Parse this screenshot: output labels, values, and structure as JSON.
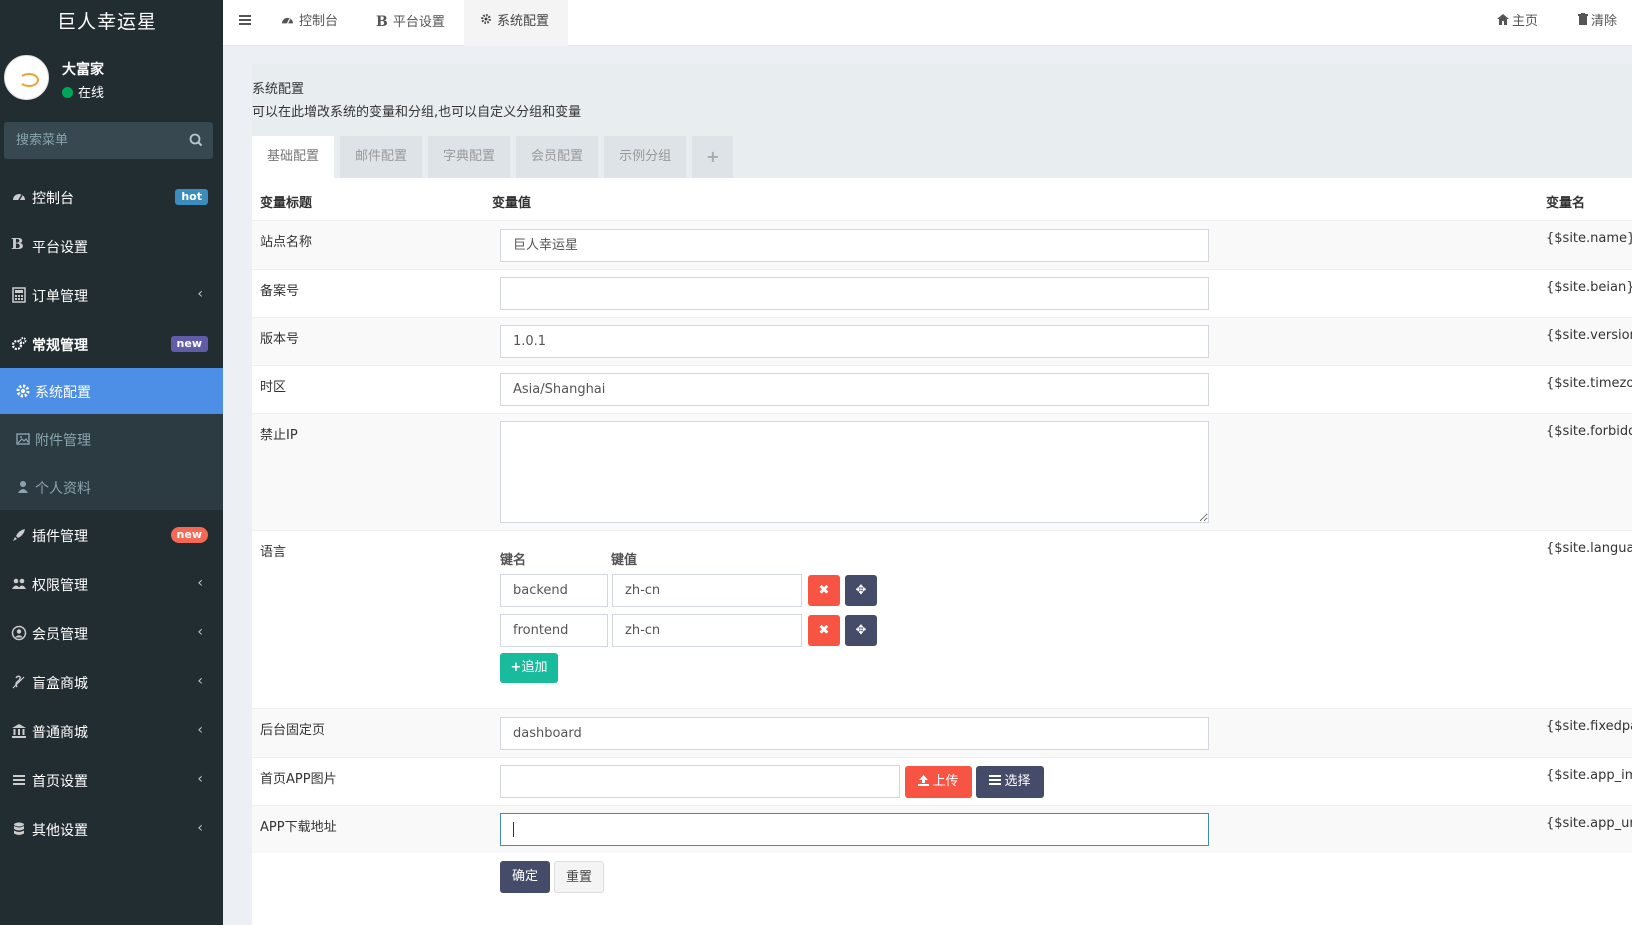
{
  "app": {
    "logo": "巨人幸运星"
  },
  "user": {
    "name": "大富家",
    "status": "在线"
  },
  "sidebar": {
    "search_placeholder": "搜索菜单",
    "items": [
      {
        "label": "控制台",
        "badge": "hot"
      },
      {
        "label": "平台设置"
      },
      {
        "label": "订单管理"
      },
      {
        "label": "常规管理",
        "badge": "new"
      },
      {
        "label": "系统配置"
      },
      {
        "label": "附件管理"
      },
      {
        "label": "个人资料"
      },
      {
        "label": "插件管理",
        "badge": "new"
      },
      {
        "label": "权限管理"
      },
      {
        "label": "会员管理"
      },
      {
        "label": "盲盒商城"
      },
      {
        "label": "普通商城"
      },
      {
        "label": "首页设置"
      },
      {
        "label": "其他设置"
      }
    ]
  },
  "topbar": {
    "tabs": [
      {
        "label": "控制台"
      },
      {
        "label": "平台设置"
      },
      {
        "label": "系统配置"
      }
    ],
    "home": "主页",
    "clear": "清除"
  },
  "config": {
    "title": "系统配置",
    "description": "可以在此增改系统的变量和分组,也可以自定义分组和变量",
    "tabs": [
      "基础配置",
      "邮件配置",
      "字典配置",
      "会员配置",
      "示例分组",
      "+"
    ],
    "columns": {
      "title": "变量标题",
      "value": "变量值",
      "name": "变量名"
    },
    "rows": [
      {
        "title": "站点名称",
        "value": "巨人幸运星",
        "var": "{$site.name}"
      },
      {
        "title": "备案号",
        "value": "",
        "var": "{$site.beian}"
      },
      {
        "title": "版本号",
        "value": "1.0.1",
        "var": "{$site.version}"
      },
      {
        "title": "时区",
        "value": "Asia/Shanghai",
        "var": "{$site.timezone}"
      },
      {
        "title": "禁止IP",
        "value": "",
        "var": "{$site.forbiddenip}"
      },
      {
        "title": "语言",
        "var": "{$site.languages}"
      },
      {
        "title": "后台固定页",
        "value": "dashboard",
        "var": "{$site.fixedpage}"
      },
      {
        "title": "首页APP图片",
        "value": "",
        "var": "{$site.app_image}"
      },
      {
        "title": "APP下载地址",
        "value": "",
        "var": "{$site.app_url}"
      }
    ],
    "language": {
      "key_label": "键名",
      "value_label": "键值",
      "pairs": [
        {
          "key": "backend",
          "value": "zh-cn"
        },
        {
          "key": "frontend",
          "value": "zh-cn"
        }
      ],
      "add_label": "追加"
    },
    "upload_label": "上传",
    "choose_label": "选择",
    "submit_label": "确定",
    "reset_label": "重置"
  },
  "colors": {
    "sidebar_bg": "#222d32",
    "active_item": "#4d8ee6",
    "hot_badge": "#3c8dbc",
    "new_badge_blue": "#605ca8",
    "new_badge_red": "#f56954",
    "danger": "#f75444",
    "dark_btn": "#444c69",
    "success": "#18bc9c"
  }
}
